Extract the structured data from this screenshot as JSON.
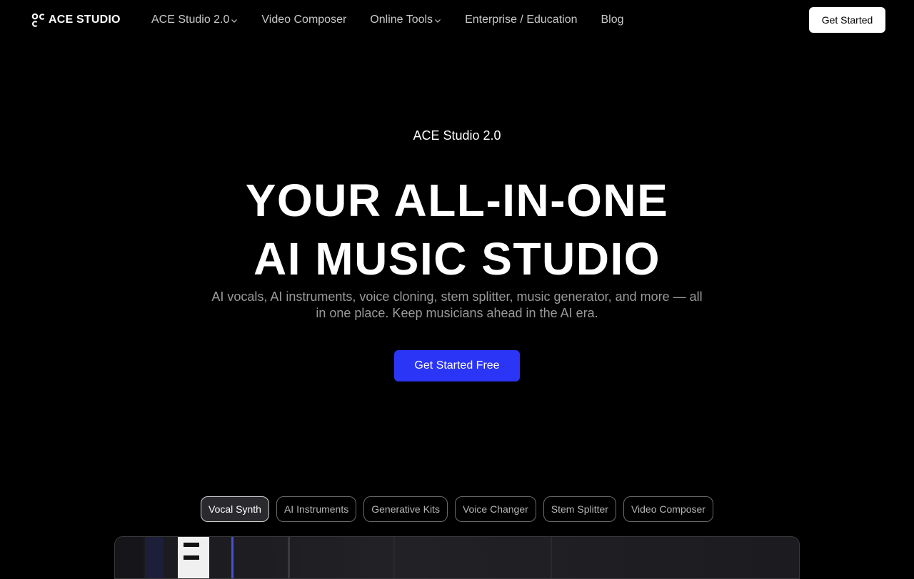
{
  "brand": {
    "name": "ACE STUDIO",
    "logo_icon": "ace-logo-icon"
  },
  "nav": {
    "links": [
      {
        "label": "ACE Studio 2.0",
        "has_dropdown": true
      },
      {
        "label": "Video Composer",
        "has_dropdown": false
      },
      {
        "label": "Online Tools",
        "has_dropdown": true
      },
      {
        "label": "Enterprise / Education",
        "has_dropdown": false
      },
      {
        "label": "Blog",
        "has_dropdown": false
      }
    ],
    "cta_label": "Get Started"
  },
  "hero": {
    "eyebrow": "ACE Studio 2.0",
    "headline_line1": "YOUR ALL-IN-ONE",
    "headline_line2": "AI MUSIC STUDIO",
    "subhead": "AI vocals, AI instruments, voice cloning, stem splitter, music generator, and more — all in one place. Keep musicians ahead in the AI era.",
    "cta_label": "Get Started Free"
  },
  "feature_tabs": {
    "items": [
      {
        "label": "Vocal Synth",
        "active": true
      },
      {
        "label": "AI Instruments",
        "active": false
      },
      {
        "label": "Generative Kits",
        "active": false
      },
      {
        "label": "Voice Changer",
        "active": false
      },
      {
        "label": "Stem Splitter",
        "active": false
      },
      {
        "label": "Video Composer",
        "active": false
      }
    ]
  },
  "colors": {
    "background": "#000000",
    "accent": "#2b35f5",
    "text_muted": "#9a9a9a",
    "nav_text": "#c8c8c8"
  }
}
